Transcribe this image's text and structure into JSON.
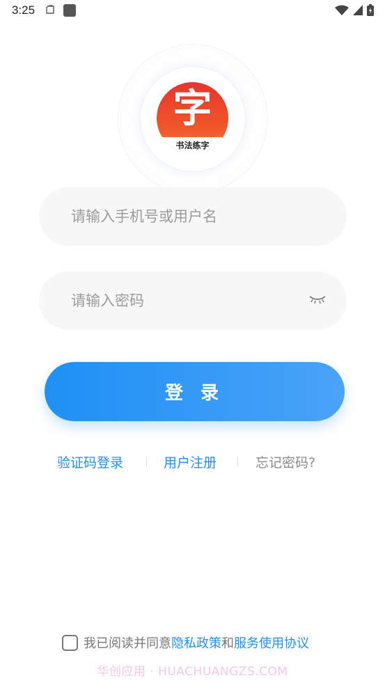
{
  "status_bar": {
    "time": "3:25",
    "icons": [
      "clipboard-icon",
      "app-square-icon",
      "wifi-icon",
      "signal-icon",
      "battery-icon"
    ]
  },
  "logo": {
    "character": "字",
    "caption": "书法练字"
  },
  "login_form": {
    "username_placeholder": "请输入手机号或用户名",
    "username_value": "",
    "password_placeholder": "请输入密码",
    "password_value": "",
    "password_toggle_icon": "eye-closed-icon",
    "submit_label": "登 录"
  },
  "links": {
    "sms_login": "验证码登录",
    "register": "用户注册",
    "forgot_password": "忘记密码?"
  },
  "agreement": {
    "checked": false,
    "prefix": "我已阅读并同意",
    "privacy_policy": "隐私政策",
    "conjunction": "和",
    "service_agreement": "服务使用协议"
  },
  "watermark": "华创应用 · HUACHUANGZS.COM",
  "colors": {
    "accent": "#1e90f6",
    "logo_red": "#e8342c",
    "muted_text": "#8a8a8a",
    "field_bg": "#f7f7f8"
  }
}
